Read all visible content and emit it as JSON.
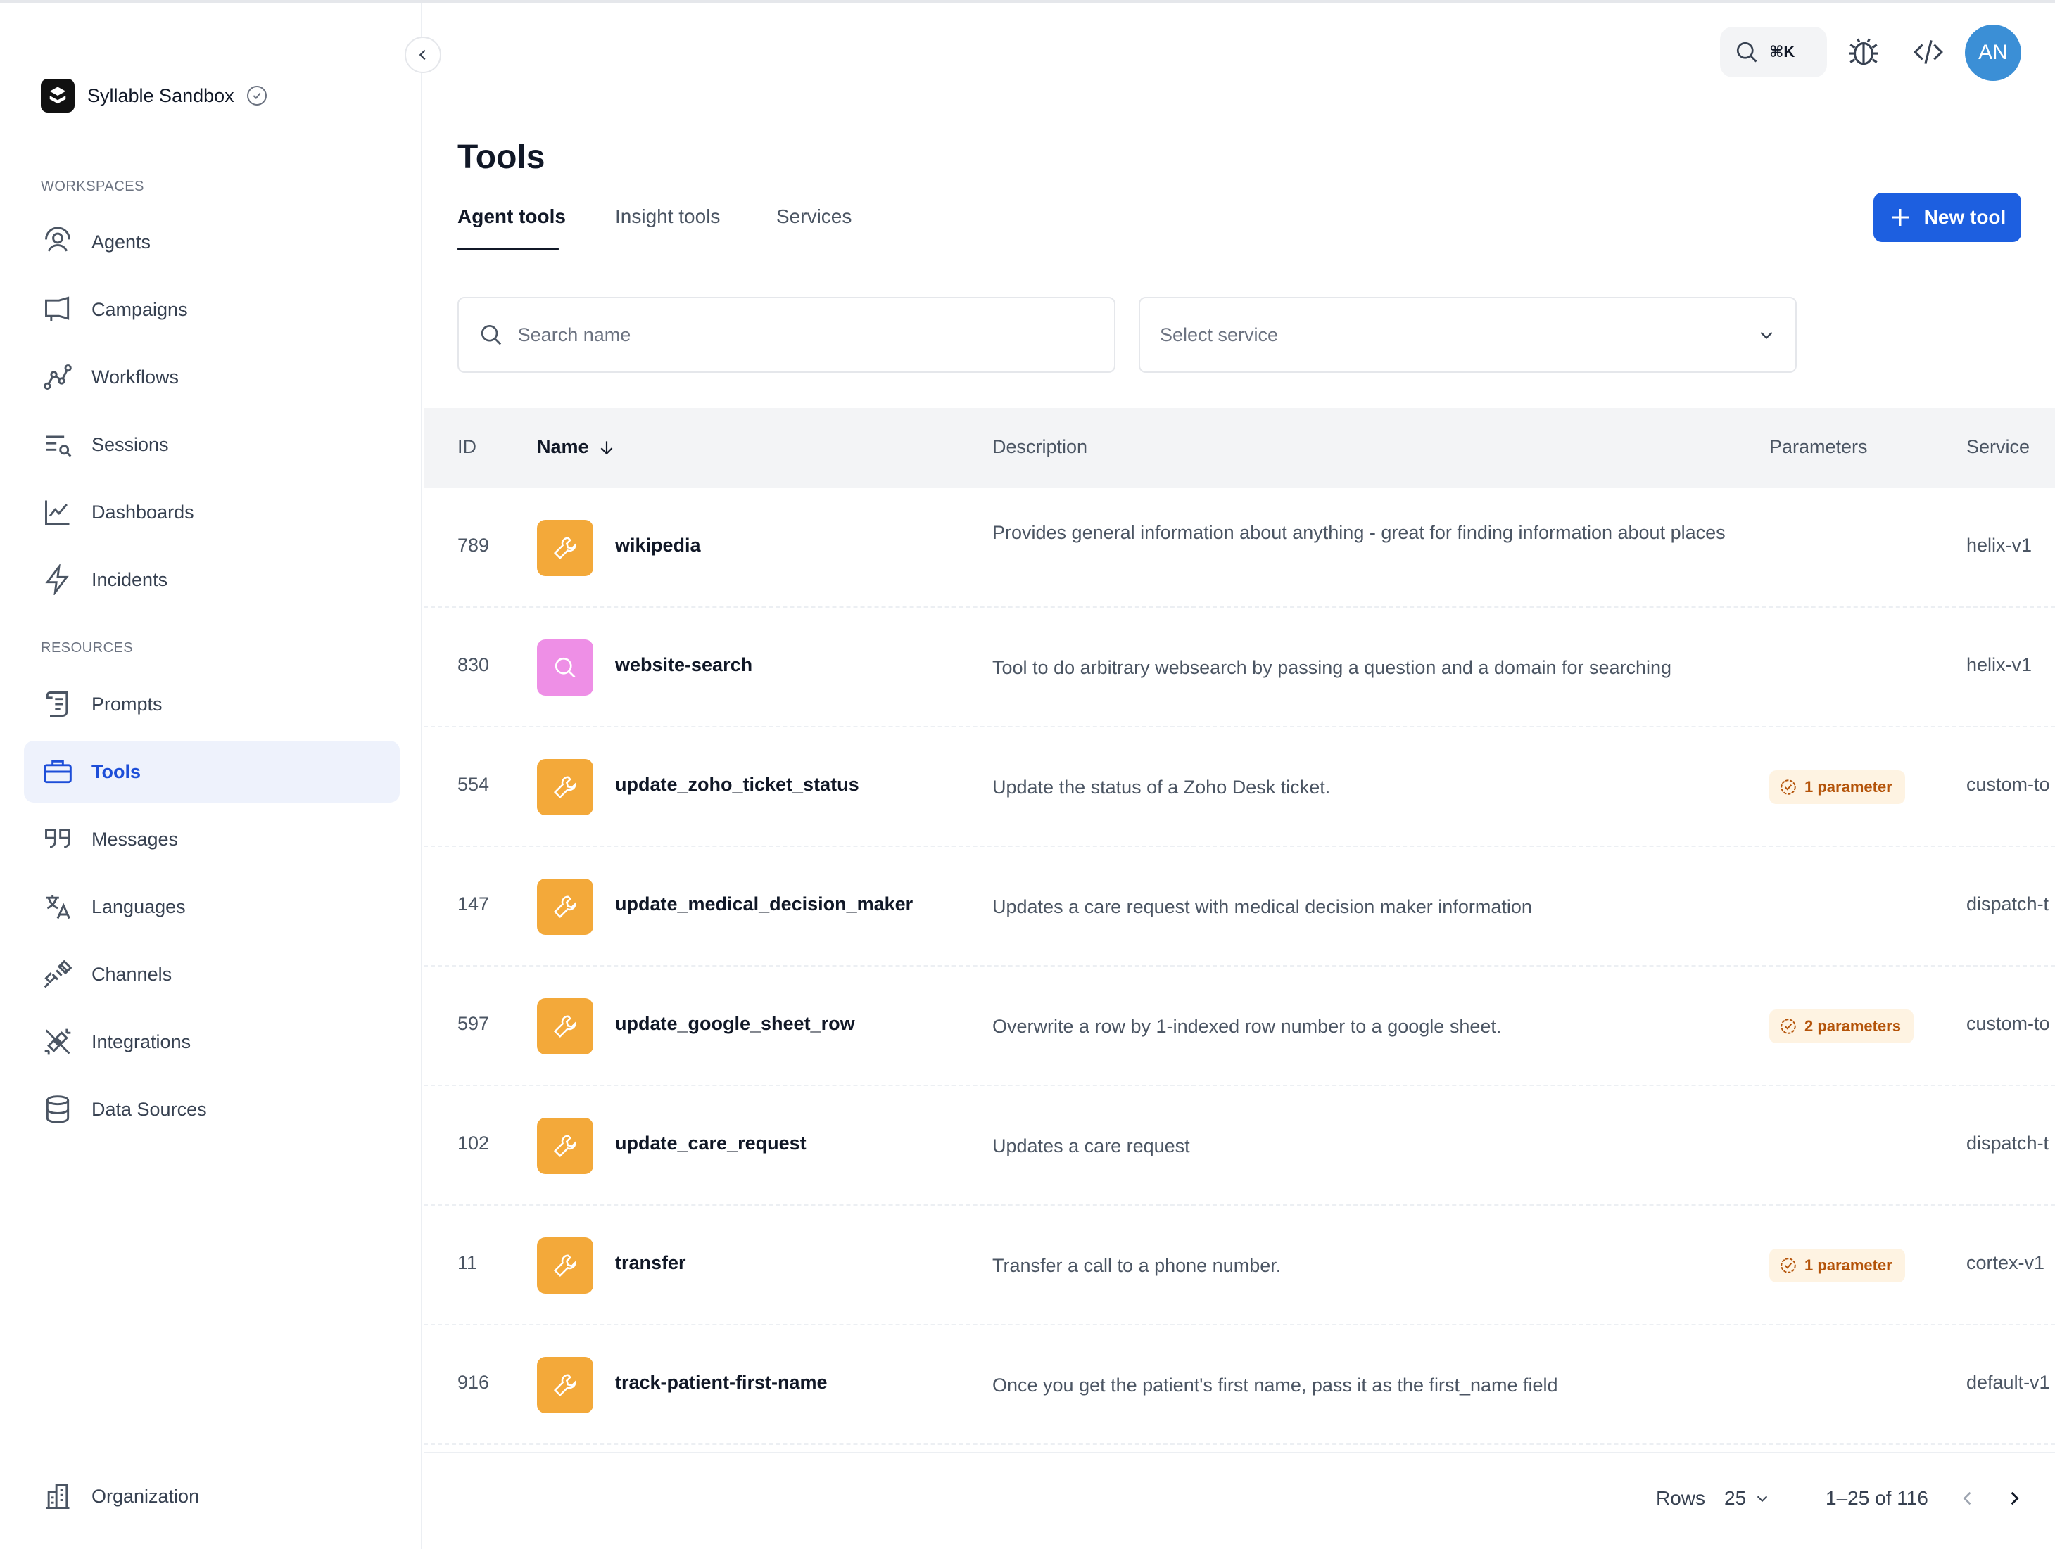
{
  "org": {
    "name": "Syllable Sandbox"
  },
  "sidebar": {
    "workspaces_label": "WORKSPACES",
    "resources_label": "RESOURCES",
    "workspaces": [
      {
        "label": "Agents",
        "icon": "agents-icon"
      },
      {
        "label": "Campaigns",
        "icon": "megaphone-icon"
      },
      {
        "label": "Workflows",
        "icon": "workflow-icon"
      },
      {
        "label": "Sessions",
        "icon": "sessions-search-icon"
      },
      {
        "label": "Dashboards",
        "icon": "chart-line-icon"
      },
      {
        "label": "Incidents",
        "icon": "lightning-icon"
      }
    ],
    "resources": [
      {
        "label": "Prompts",
        "icon": "scroll-icon"
      },
      {
        "label": "Tools",
        "icon": "toolbox-icon",
        "active": true
      },
      {
        "label": "Messages",
        "icon": "quote-icon"
      },
      {
        "label": "Languages",
        "icon": "translate-icon"
      },
      {
        "label": "Channels",
        "icon": "plug-icon"
      },
      {
        "label": "Integrations",
        "icon": "integration-plug-icon"
      },
      {
        "label": "Data Sources",
        "icon": "database-icon"
      }
    ],
    "bottom": {
      "label": "Organization",
      "icon": "building-icon"
    }
  },
  "topbar": {
    "shortcut": "⌘K",
    "avatar_initials": "AN"
  },
  "page": {
    "title": "Tools",
    "tabs": [
      "Agent tools",
      "Insight tools",
      "Services"
    ],
    "new_tool_label": "New tool",
    "search_placeholder": "Search name",
    "select_placeholder": "Select service"
  },
  "table": {
    "headers": {
      "id": "ID",
      "name": "Name",
      "description": "Description",
      "parameters": "Parameters",
      "service": "Service"
    },
    "rows": [
      {
        "id": "789",
        "name": "wikipedia",
        "icon": "wrench-icon",
        "description": "Provides general information about anything - great for finding information about places",
        "parameters": "",
        "service": "helix-v1"
      },
      {
        "id": "830",
        "name": "website-search",
        "icon": "search-icon",
        "description": "Tool to do arbitrary websearch by passing a question and a domain for searching",
        "parameters": "",
        "service": "helix-v1"
      },
      {
        "id": "554",
        "name": "update_zoho_ticket_status",
        "icon": "wrench-icon",
        "description": "Update the status of a Zoho Desk ticket.",
        "parameters": "1 parameter",
        "service": "custom-to"
      },
      {
        "id": "147",
        "name": "update_medical_decision_maker",
        "icon": "wrench-icon",
        "description": "Updates a care request with medical decision maker information",
        "parameters": "",
        "service": "dispatch-t"
      },
      {
        "id": "597",
        "name": "update_google_sheet_row",
        "icon": "wrench-icon",
        "description": "Overwrite a row by 1-indexed row number to a google sheet.",
        "parameters": "2 parameters",
        "service": "custom-to"
      },
      {
        "id": "102",
        "name": "update_care_request",
        "icon": "wrench-icon",
        "description": "Updates a care request",
        "parameters": "",
        "service": "dispatch-t"
      },
      {
        "id": "11",
        "name": "transfer",
        "icon": "wrench-icon",
        "description": "Transfer a call to a phone number.",
        "parameters": "1 parameter",
        "service": "cortex-v1"
      },
      {
        "id": "916",
        "name": "track-patient-first-name",
        "icon": "wrench-icon",
        "description": "Once you get the patient's first name, pass it as the first_name field",
        "parameters": "",
        "service": "default-v1"
      }
    ]
  },
  "footer": {
    "rows_label": "Rows",
    "rows_value": "25",
    "range": "1–25 of 116"
  },
  "colors": {
    "accent": "#1d5fe0",
    "active_nav_bg": "#eef2fc",
    "wrench_tile": "#f3a93a",
    "search_tile": "#ee8fe6",
    "badge_bg": "#fef3e2",
    "badge_text": "#b45309",
    "avatar": "#3b8fd6"
  }
}
